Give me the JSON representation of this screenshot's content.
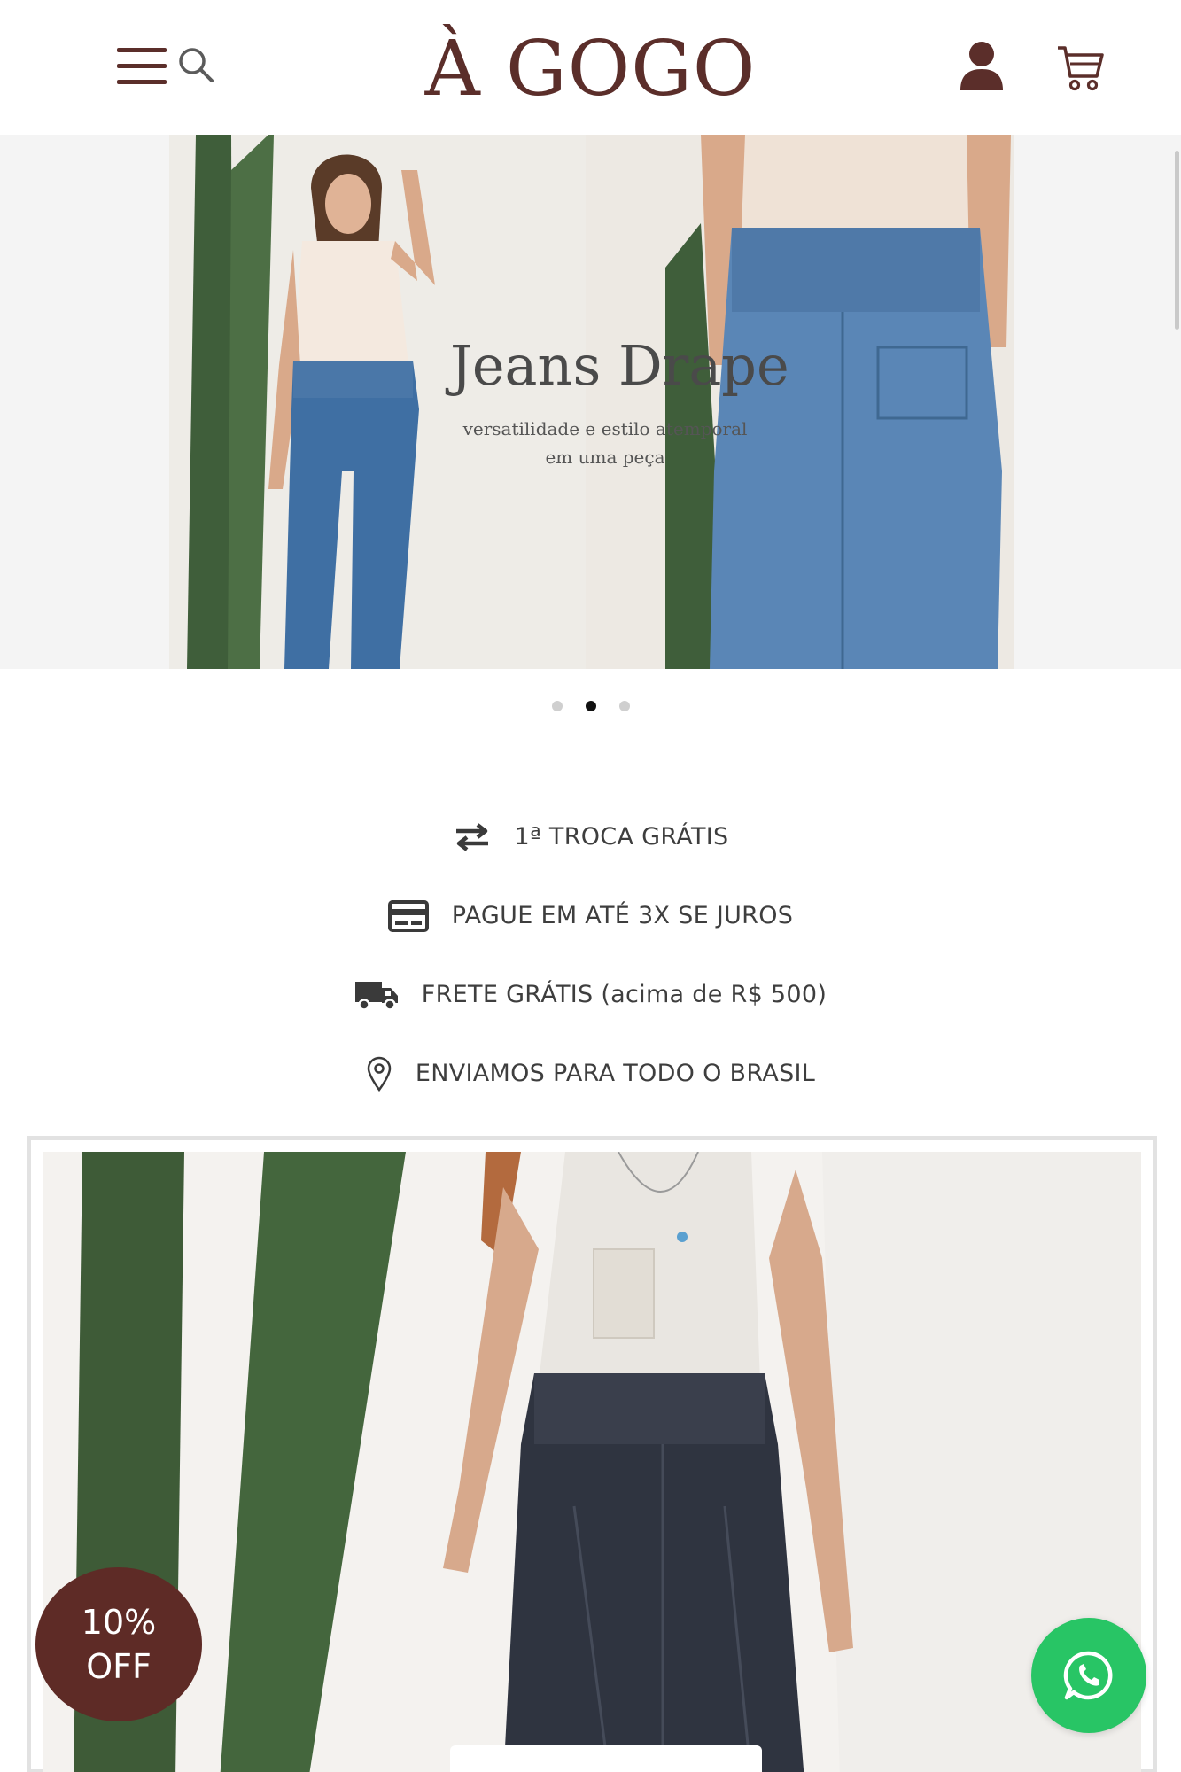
{
  "header": {
    "logo": "À GOGO",
    "menu_icon": "hamburger-menu-icon",
    "search_icon": "search-icon",
    "account_icon": "user-icon",
    "cart_icon": "shopping-cart-icon",
    "brand_color": "#5b2e2a"
  },
  "banner": {
    "title": "Jeans Drape",
    "subtitle_line1": "versatilidade e estilo atemporal",
    "subtitle_line2": "em uma peça",
    "active_slide": 2,
    "slides": 3
  },
  "benefits": [
    {
      "icon": "exchange-arrows-icon",
      "label": "1ª TROCA GRÁTIS"
    },
    {
      "icon": "credit-card-icon",
      "label": "PAGUE EM ATÉ 3X SE JUROS"
    },
    {
      "icon": "delivery-truck-icon",
      "label": "FRETE GRÁTIS (acima de R$ 500)"
    },
    {
      "icon": "location-pin-icon",
      "label": "ENVIAMOS PARA TODO O BRASIL"
    }
  ],
  "discount": {
    "line1": "10%",
    "line2": "OFF",
    "color": "#5e2b26"
  },
  "whatsapp": {
    "icon": "whatsapp-icon",
    "color": "#28c565"
  }
}
